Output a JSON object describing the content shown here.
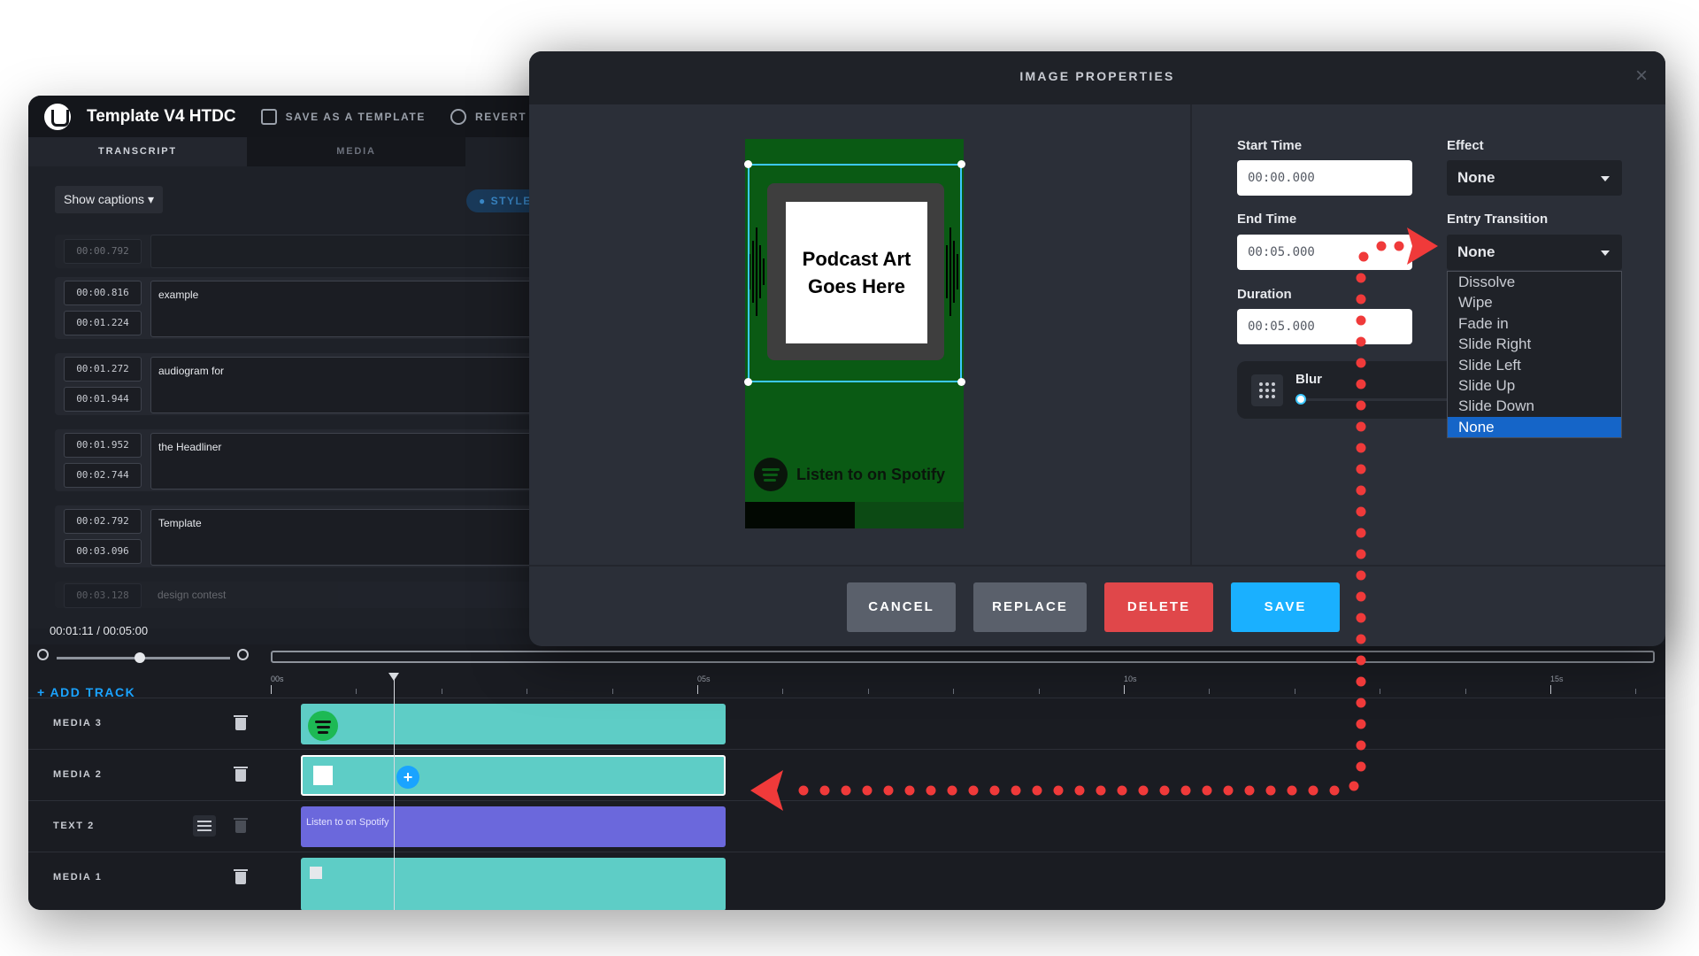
{
  "app": {
    "project_title": "Template V4 HTDC",
    "save_template_label": "SAVE AS A TEMPLATE",
    "revert_label": "REVERT",
    "tabs": [
      "TRANSCRIPT",
      "MEDIA"
    ],
    "show_captions_label": "Show captions",
    "style_label": "STYLE",
    "captions": [
      {
        "start": "00:00.792",
        "end": "",
        "text": ""
      },
      {
        "start": "00:00.816",
        "end": "00:01.224",
        "text": "example"
      },
      {
        "start": "00:01.272",
        "end": "00:01.944",
        "text": "audiogram for"
      },
      {
        "start": "00:01.952",
        "end": "00:02.744",
        "text": "the Headliner"
      },
      {
        "start": "00:02.792",
        "end": "00:03.096",
        "text": "Template"
      },
      {
        "start": "00:03.128",
        "end": "",
        "text": "design contest"
      }
    ],
    "time_readout": "00:01:11 / 00:05:00"
  },
  "timeline": {
    "add_track_label": "+ ADD TRACK",
    "ruler_labels": [
      "00s",
      "05s",
      "10s",
      "15s"
    ],
    "tracks": [
      {
        "label": "MEDIA 3"
      },
      {
        "label": "MEDIA 2"
      },
      {
        "label": "TEXT 2",
        "clip_text": "Listen to on Spotify"
      },
      {
        "label": "MEDIA 1"
      }
    ]
  },
  "modal": {
    "title": "IMAGE PROPERTIES",
    "close_glyph": "×",
    "preview": {
      "art_text_line1": "Podcast Art",
      "art_text_line2": "Goes Here",
      "spotify_text": "Listen to on Spotify"
    },
    "start_time_label": "Start Time",
    "start_time_value": "00:00.000",
    "end_time_label": "End Time",
    "end_time_value": "00:05.000",
    "duration_label": "Duration",
    "duration_value": "00:05.000",
    "effect_label": "Effect",
    "effect_value": "None",
    "entry_transition_label": "Entry Transition",
    "entry_transition_value": "None",
    "entry_transition_options": [
      "Dissolve",
      "Wipe",
      "Fade in",
      "Slide Right",
      "Slide Left",
      "Slide Up",
      "Slide Down",
      "None"
    ],
    "entry_transition_selected": "None",
    "blur_label": "Blur",
    "blur_level": 0,
    "buttons": {
      "cancel": "CANCEL",
      "replace": "REPLACE",
      "delete": "DELETE",
      "save": "SAVE"
    }
  },
  "colors": {
    "accent_blue": "#1ab0ff",
    "delete_red": "#e0474a",
    "clip_teal": "#5ecdc6",
    "clip_purple": "#6b68dc",
    "annotation_red": "#f03a3a",
    "preview_green": "#0a5a14"
  }
}
